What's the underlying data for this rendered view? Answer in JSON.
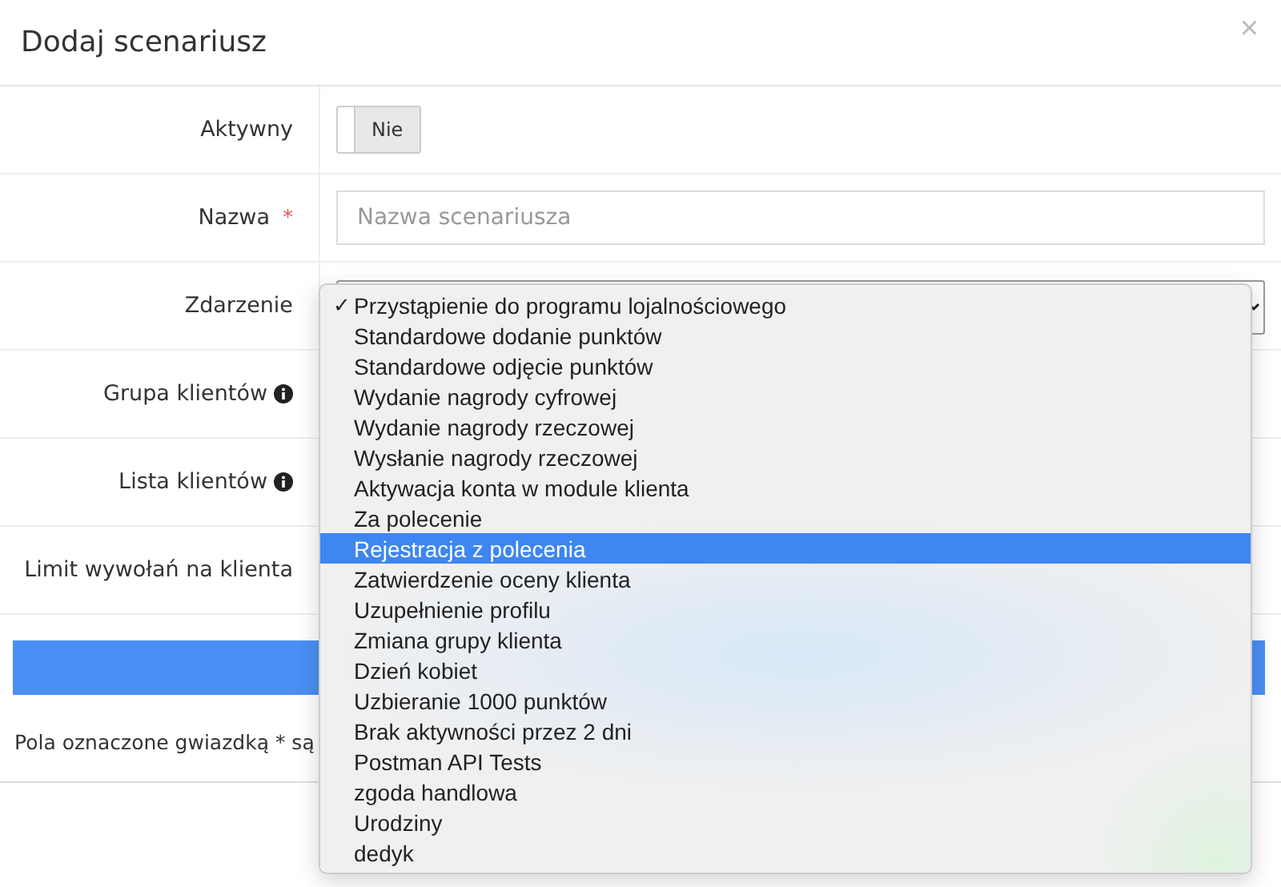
{
  "dialog": {
    "title": "Dodaj scenariusz",
    "close": "×"
  },
  "rows": [
    {
      "label": "Aktywny",
      "kind": "toggle",
      "toggle": {
        "on": false,
        "text": "Nie"
      }
    },
    {
      "label": "Nazwa",
      "required": true,
      "required_mark": "*",
      "kind": "input",
      "placeholder": "Nazwa scenariusza"
    },
    {
      "label": "Zdarzenie",
      "kind": "select"
    },
    {
      "label": "Grupa klientów",
      "info": true,
      "kind": "none"
    },
    {
      "label": "Lista klientów",
      "info": true,
      "kind": "none"
    },
    {
      "label": "Limit wywołań na klienta",
      "kind": "none"
    }
  ],
  "footer_note": "Pola oznaczone gwiazdką * są",
  "dropdown": {
    "check_mark": "✓",
    "items": [
      {
        "label": "Przystąpienie do programu lojalnościowego",
        "checked": true,
        "selected": false
      },
      {
        "label": "Standardowe dodanie punktów",
        "checked": false,
        "selected": false
      },
      {
        "label": "Standardowe odjęcie punktów",
        "checked": false,
        "selected": false
      },
      {
        "label": "Wydanie nagrody cyfrowej",
        "checked": false,
        "selected": false
      },
      {
        "label": "Wydanie nagrody rzeczowej",
        "checked": false,
        "selected": false
      },
      {
        "label": "Wysłanie nagrody rzeczowej",
        "checked": false,
        "selected": false
      },
      {
        "label": "Aktywacja konta w module klienta",
        "checked": false,
        "selected": false
      },
      {
        "label": "Za polecenie",
        "checked": false,
        "selected": false
      },
      {
        "label": "Rejestracja z polecenia",
        "checked": false,
        "selected": true
      },
      {
        "label": "Zatwierdzenie oceny klienta",
        "checked": false,
        "selected": false
      },
      {
        "label": "Uzupełnienie profilu",
        "checked": false,
        "selected": false
      },
      {
        "label": "Zmiana grupy klienta",
        "checked": false,
        "selected": false
      },
      {
        "label": "Dzień kobiet",
        "checked": false,
        "selected": false
      },
      {
        "label": "Uzbieranie 1000 punktów",
        "checked": false,
        "selected": false
      },
      {
        "label": "Brak aktywności przez 2 dni",
        "checked": false,
        "selected": false
      },
      {
        "label": "Postman API Tests",
        "checked": false,
        "selected": false
      },
      {
        "label": "zgoda handlowa",
        "checked": false,
        "selected": false
      },
      {
        "label": "Urodziny",
        "checked": false,
        "selected": false
      },
      {
        "label": "dedyk",
        "checked": false,
        "selected": false
      }
    ]
  }
}
